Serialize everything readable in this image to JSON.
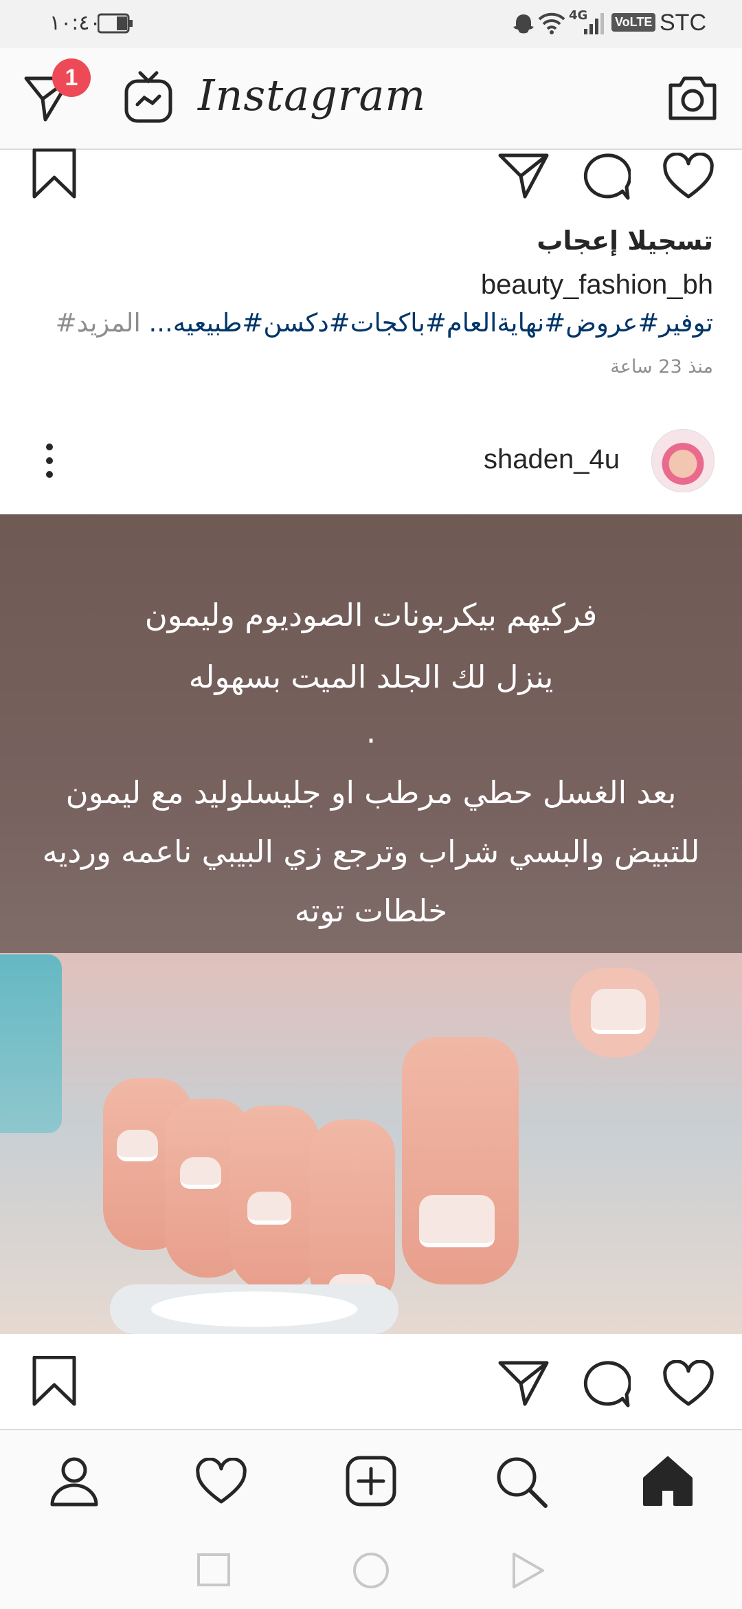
{
  "status_bar": {
    "time": "١٠:٤٠",
    "network": "4G",
    "volte": "VoLTE",
    "carrier": "STC"
  },
  "header": {
    "app_name": "Instagram",
    "dm_badge_count": "1",
    "icons": [
      "direct-message-icon",
      "igtv-icon",
      "camera-icon"
    ]
  },
  "post1": {
    "likes_text": "تسجيلا إعجاب",
    "username": "beauty_fashion_bh",
    "caption_hashtags": "توفير#عروض#نهاية‌العام#باكجات#دكسن#طبيعيه...",
    "more_label": "المزيد#",
    "time_ago": "منذ 23 ساعة"
  },
  "post2": {
    "username": "shaden_4u",
    "image_text": {
      "line1": "فركيهم بيكربونات الصوديوم وليمون",
      "line2": "ينزل لك الجلد الميت بسهوله",
      "line3": ".",
      "line4": "بعد الغسل حطي مرطب او جليسلوليد مع ليمون",
      "line5": "للتبيض والبسي شراب وترجع زي البيبي ناعمه ورديه",
      "line6": "خلطات توته"
    }
  },
  "bottom_nav": {
    "items": [
      "profile-icon",
      "activity-heart-icon",
      "new-post-icon",
      "search-icon",
      "home-icon"
    ]
  },
  "system_nav": [
    "recents-icon",
    "home-circle-icon",
    "back-icon"
  ]
}
